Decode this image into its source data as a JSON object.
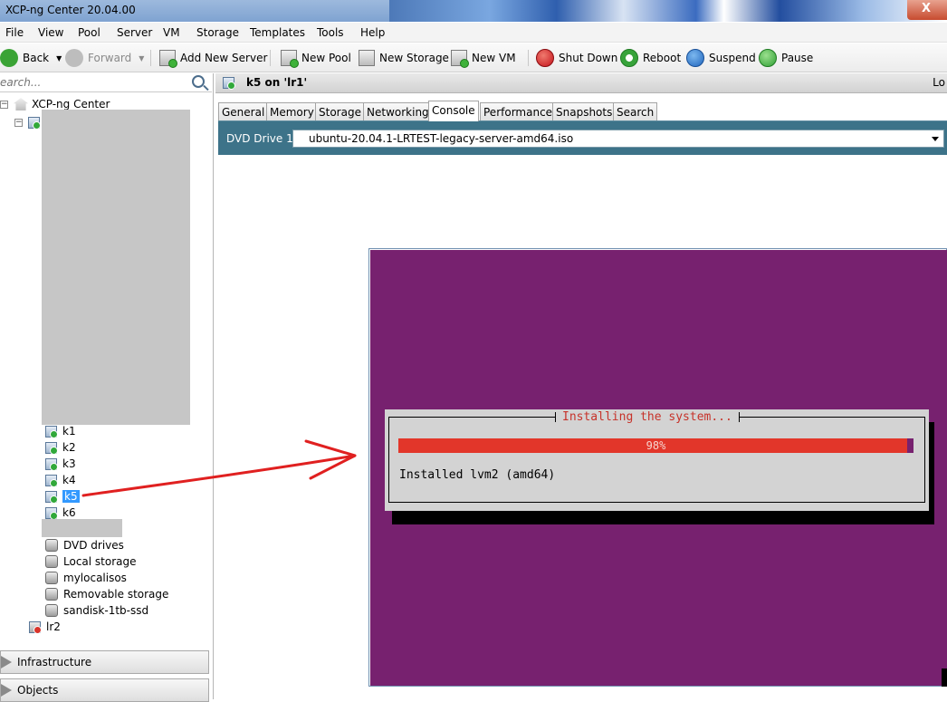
{
  "window": {
    "title": "XCP-ng Center 20.04.00",
    "close_glyph": "X"
  },
  "menu": [
    "File",
    "View",
    "Pool",
    "Server",
    "VM",
    "Storage",
    "Templates",
    "Tools",
    "Help"
  ],
  "toolbar": {
    "back": "Back",
    "forward": "Forward",
    "add_server": "Add New Server",
    "new_pool": "New Pool",
    "new_storage": "New Storage",
    "new_vm": "New VM",
    "shutdown": "Shut Down",
    "reboot": "Reboot",
    "suspend": "Suspend",
    "pause": "Pause"
  },
  "search": {
    "placeholder": "earch..."
  },
  "tree": {
    "root": "XCP-ng Center",
    "vms": [
      "k1",
      "k2",
      "k3",
      "k4",
      "k5",
      "k6"
    ],
    "selected": "k5",
    "storage": [
      "DVD drives",
      "Local storage",
      "mylocalisos",
      "Removable storage",
      "sandisk-1tb-ssd"
    ],
    "host2": "lr2"
  },
  "bottom_tabs": {
    "infrastructure": "Infrastructure",
    "objects": "Objects"
  },
  "main": {
    "title": "k5 on 'lr1'",
    "header_right": "Lo",
    "tabs": [
      "General",
      "Memory",
      "Storage",
      "Networking",
      "Console",
      "Performance",
      "Snapshots",
      "Search"
    ],
    "active_tab": "Console"
  },
  "dvd": {
    "label": "DVD Drive 1:",
    "value": "ubuntu-20.04.1-LRTEST-legacy-server-amd64.iso"
  },
  "console": {
    "dialog_title": "Installing the system...",
    "progress_text": "98%",
    "progress": 0.98,
    "status": "Installed lvm2 (amd64)"
  },
  "colors": {
    "console_bg": "#77216f",
    "progress_bar": "#e2362a",
    "dialog_bg": "#d3d3d3",
    "dvd_bar": "#3d7389",
    "selection": "#3399ff",
    "annotation_arrow": "#e02020"
  },
  "icons": {
    "back": "back-arrow-icon",
    "forward": "forward-arrow-icon",
    "shutdown": "power-icon",
    "reboot": "reboot-icon",
    "suspend": "suspend-icon",
    "pause": "pause-icon",
    "search": "search-icon"
  }
}
